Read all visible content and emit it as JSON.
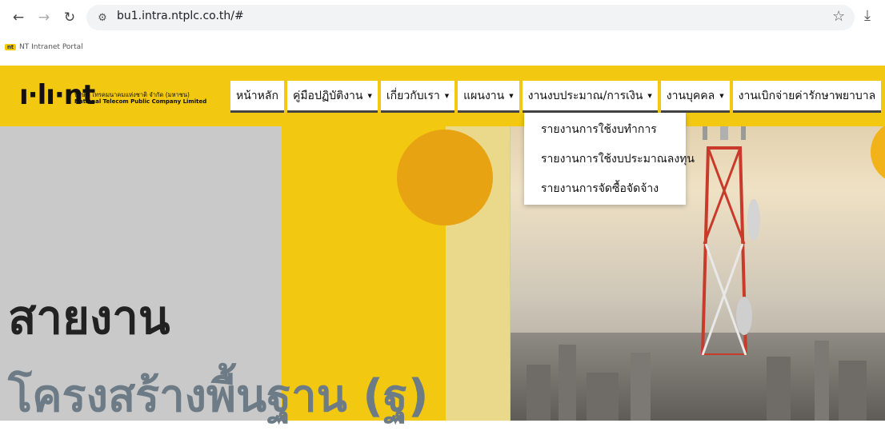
{
  "browser": {
    "url": "bu1.intra.ntplc.co.th/#",
    "bookmark": "NT Intranet Portal",
    "bookmark_icon": "nt"
  },
  "logo": {
    "mark": "ı·lı·nt",
    "company_th": "บริษัท โทรคมนาคมแห่งชาติ จำกัด (มหาชน)",
    "company_en": "National Telecom Public Company Limited"
  },
  "menu": [
    {
      "label": "หน้าหลัก"
    },
    {
      "label": "คู่มือปฏิบัติงาน"
    },
    {
      "label": "เกี่ยวกับเรา"
    },
    {
      "label": "แผนงาน"
    },
    {
      "label": "งานงบประมาณ/การเงิน"
    },
    {
      "label": "งานบุคคล"
    },
    {
      "label": "งานเบิกจ่ายค่ารักษาพยาบาล"
    }
  ],
  "dropdown": [
    {
      "label": "รายงานการใช้งบทำการ"
    },
    {
      "label": "รายงานการใช้งบประมาณลงทุน"
    },
    {
      "label": "รายงานการจัดซื้อจัดจ้าง"
    }
  ],
  "hero": {
    "title": "สายงาน",
    "subtitle": "โครงสร้างพื้นฐาน (ฐ)"
  },
  "colors": {
    "brand_yellow": "#f2c811",
    "accent_orange": "#e8a313",
    "menu_active": "#111111"
  }
}
